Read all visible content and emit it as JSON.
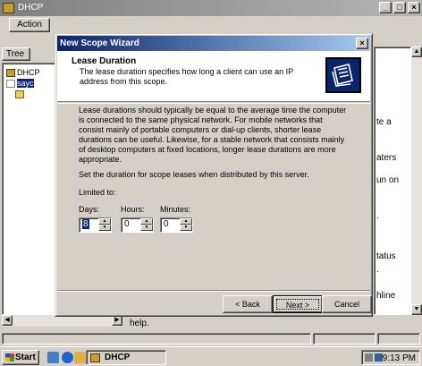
{
  "outer_window": {
    "title": "DHCP",
    "menu_action": "Action",
    "tree_tab": "Tree",
    "tree_items": [
      "DHCP",
      "sayc"
    ],
    "right_fragments": [
      "te a",
      "aters",
      "un on",
      ".",
      "tatus",
      ".",
      "hline"
    ],
    "help_fragment": "help."
  },
  "wizard": {
    "title": "New Scope Wizard",
    "heading": "Lease Duration",
    "subheading": "The lease duration specifies how long a client can use an IP address from this scope.",
    "body": "Lease durations should typically be equal to the average time the computer is connected to the same physical network. For mobile networks that consist mainly of portable computers or dial-up clients, shorter lease durations can be useful. Likewise, for a stable network that consists mainly of desktop computers at fixed locations, longer lease durations are more appropriate.",
    "set_duration": "Set the duration for scope leases when distributed by this server.",
    "limited_to": "Limited to:",
    "fields": {
      "days": {
        "label": "Days:",
        "value": "8"
      },
      "hours": {
        "label": "Hours:",
        "value": "0"
      },
      "minutes": {
        "label": "Minutes:",
        "value": "0"
      }
    },
    "buttons": {
      "back": "< Back",
      "next": "Next >",
      "cancel": "Cancel"
    }
  },
  "taskbar": {
    "start": "Start",
    "task": "DHCP",
    "clock": "9:13 PM"
  },
  "colors": {
    "wizard_title_start": "#0a246a",
    "wizard_title_end": "#a6caf0",
    "face": "#d4d0c8"
  }
}
